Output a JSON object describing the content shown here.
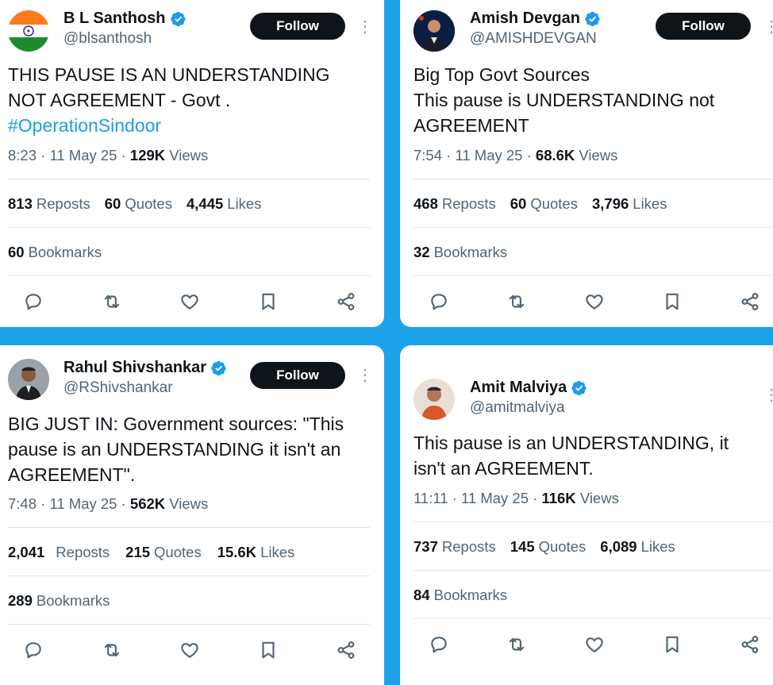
{
  "colors": {
    "background": "#1da1e8",
    "verified": "#1d9bf0",
    "follow_bg": "#0f1419",
    "muted": "#536471"
  },
  "tweets": [
    {
      "name": "B L Santhosh",
      "handle": "@blsanthosh",
      "follow_label": "Follow",
      "text": "THIS PAUSE IS AN UNDERSTANDING\nNOT AGREEMENT - Govt .",
      "hashtag": "#OperationSindoor",
      "time": "8:23 · 11 May 25 · ",
      "views_num": "129K",
      "views_label": "Views",
      "reposts_num": "813",
      "reposts_label": "Reposts",
      "quotes_num": "60",
      "quotes_label": "Quotes",
      "likes_num": "4,445",
      "likes_label": "Likes",
      "bookmarks_num": "60",
      "bookmarks_label": "Bookmarks"
    },
    {
      "name": "Amish Devgan",
      "handle": "@AMISHDEVGAN",
      "follow_label": "Follow",
      "text": "Big Top Govt Sources\nThis pause is UNDERSTANDING not\nAGREEMENT",
      "time": "7:54 · 11 May 25 · ",
      "views_num": "68.6K",
      "views_label": "Views",
      "reposts_num": "468",
      "reposts_label": "Reposts",
      "quotes_num": "60",
      "quotes_label": "Quotes",
      "likes_num": "3,796",
      "likes_label": "Likes",
      "bookmarks_num": "32",
      "bookmarks_label": "Bookmarks"
    },
    {
      "name": "Rahul Shivshankar",
      "handle": "@RShivshankar",
      "follow_label": "Follow",
      "text": "BIG JUST IN: Government sources: \"This\npause is an UNDERSTANDING it isn't an\nAGREEMENT\".",
      "time": "7:48 · 11 May 25 · ",
      "views_num": "562K",
      "views_label": "Views",
      "reposts_num": "2,041",
      "reposts_label": "Reposts",
      "quotes_num": "215",
      "quotes_label": "Quotes",
      "likes_num": "15.6K",
      "likes_label": "Likes",
      "bookmarks_num": "289",
      "bookmarks_label": "Bookmarks"
    },
    {
      "name": "Amit Malviya",
      "handle": "@amitmalviya",
      "text": "This pause is an UNDERSTANDING, it\nisn't an AGREEMENT.",
      "time": "11:11 · 11 May 25 · ",
      "views_num": "116K",
      "views_label": "Views",
      "reposts_num": "737",
      "reposts_label": "Reposts",
      "quotes_num": "145",
      "quotes_label": "Quotes",
      "likes_num": "6,089",
      "likes_label": "Likes",
      "bookmarks_num": "84",
      "bookmarks_label": "Bookmarks"
    }
  ]
}
